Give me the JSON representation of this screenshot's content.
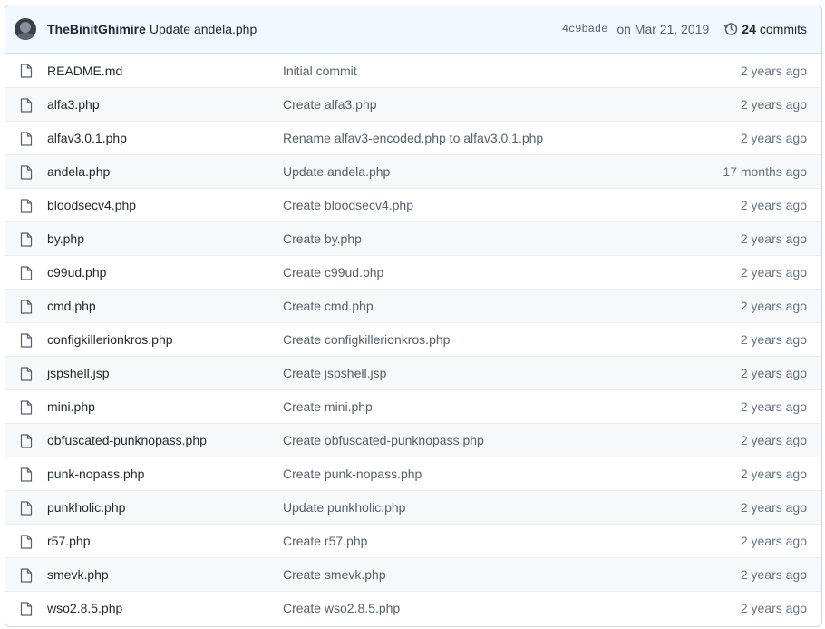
{
  "commit": {
    "author": "TheBinitGhimire",
    "message": "Update andela.php",
    "sha": "4c9bade",
    "date": "on Mar 21, 2019",
    "commit_count": "24",
    "commits_label": "commits"
  },
  "files": [
    {
      "name": "README.md",
      "message": "Initial commit",
      "age": "2 years ago"
    },
    {
      "name": "alfa3.php",
      "message": "Create alfa3.php",
      "age": "2 years ago"
    },
    {
      "name": "alfav3.0.1.php",
      "message": "Rename alfav3-encoded.php to alfav3.0.1.php",
      "age": "2 years ago"
    },
    {
      "name": "andela.php",
      "message": "Update andela.php",
      "age": "17 months ago"
    },
    {
      "name": "bloodsecv4.php",
      "message": "Create bloodsecv4.php",
      "age": "2 years ago"
    },
    {
      "name": "by.php",
      "message": "Create by.php",
      "age": "2 years ago"
    },
    {
      "name": "c99ud.php",
      "message": "Create c99ud.php",
      "age": "2 years ago"
    },
    {
      "name": "cmd.php",
      "message": "Create cmd.php",
      "age": "2 years ago"
    },
    {
      "name": "configkillerionkros.php",
      "message": "Create configkillerionkros.php",
      "age": "2 years ago"
    },
    {
      "name": "jspshell.jsp",
      "message": "Create jspshell.jsp",
      "age": "2 years ago"
    },
    {
      "name": "mini.php",
      "message": "Create mini.php",
      "age": "2 years ago"
    },
    {
      "name": "obfuscated-punknopass.php",
      "message": "Create obfuscated-punknopass.php",
      "age": "2 years ago"
    },
    {
      "name": "punk-nopass.php",
      "message": "Create punk-nopass.php",
      "age": "2 years ago"
    },
    {
      "name": "punkholic.php",
      "message": "Update punkholic.php",
      "age": "2 years ago"
    },
    {
      "name": "r57.php",
      "message": "Create r57.php",
      "age": "2 years ago"
    },
    {
      "name": "smevk.php",
      "message": "Create smevk.php",
      "age": "2 years ago"
    },
    {
      "name": "wso2.8.5.php",
      "message": "Create wso2.8.5.php",
      "age": "2 years ago"
    }
  ],
  "icons": {
    "file": "file-icon",
    "history": "history-icon",
    "avatar": "avatar"
  }
}
